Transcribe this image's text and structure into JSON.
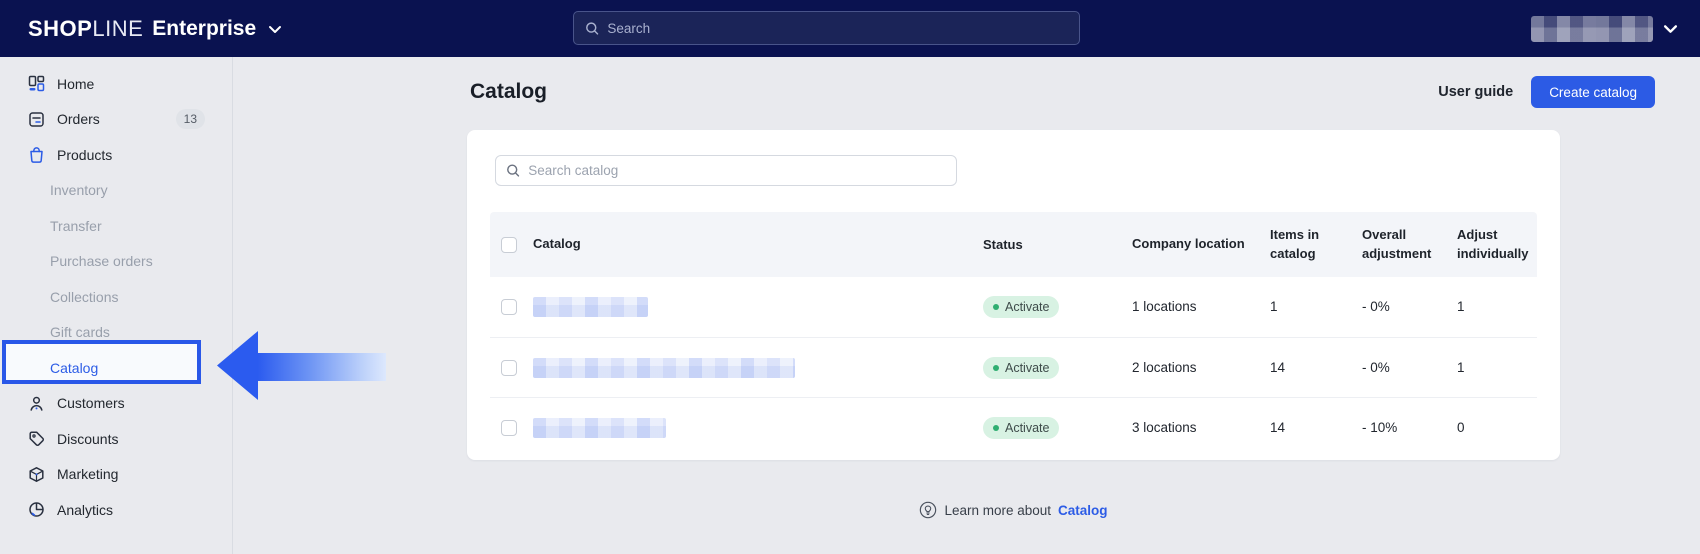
{
  "topbar": {
    "brand": {
      "shop": "SHOP",
      "line": "LINE",
      "suffix": "Enterprise"
    },
    "search_placeholder": "Search"
  },
  "sidebar": {
    "items": [
      {
        "label": "Home",
        "icon": "home-icon",
        "type": "top"
      },
      {
        "label": "Orders",
        "icon": "orders-icon",
        "type": "top",
        "badge": "13"
      },
      {
        "label": "Products",
        "icon": "products-icon",
        "type": "top"
      },
      {
        "label": "Inventory",
        "type": "sub"
      },
      {
        "label": "Transfer",
        "type": "sub"
      },
      {
        "label": "Purchase orders",
        "type": "sub"
      },
      {
        "label": "Collections",
        "type": "sub"
      },
      {
        "label": "Gift cards",
        "type": "sub"
      },
      {
        "label": "Catalog",
        "type": "sub",
        "active": true
      },
      {
        "label": "Customers",
        "icon": "customers-icon",
        "type": "top"
      },
      {
        "label": "Discounts",
        "icon": "discounts-icon",
        "type": "top"
      },
      {
        "label": "Marketing",
        "icon": "marketing-icon",
        "type": "top"
      },
      {
        "label": "Analytics",
        "icon": "analytics-icon",
        "type": "top"
      }
    ]
  },
  "page": {
    "title": "Catalog",
    "user_guide": "User guide",
    "create_catalog": "Create catalog",
    "search_placeholder": "Search catalog"
  },
  "table": {
    "headers": {
      "catalog": "Catalog",
      "status": "Status",
      "location": "Company location",
      "items": "Items in catalog",
      "overall": "Overall adjustment",
      "adjust": "Adjust individually"
    },
    "rows": [
      {
        "status": "Activate",
        "location": "1 locations",
        "items": "1",
        "overall": "- 0%",
        "adjust": "1"
      },
      {
        "status": "Activate",
        "location": "2 locations",
        "items": "14",
        "overall": "- 0%",
        "adjust": "1"
      },
      {
        "status": "Activate",
        "location": "3 locations",
        "items": "14",
        "overall": "- 10%",
        "adjust": "0"
      }
    ]
  },
  "footer": {
    "text": "Learn more about",
    "link": "Catalog"
  },
  "colors": {
    "accent": "#2C5CE6",
    "topbar_navy": "#0A1250",
    "badge_green_bg": "#D8F2E3",
    "badge_green_dot": "#2FAE71",
    "annotation_blue": "#2957E8"
  }
}
